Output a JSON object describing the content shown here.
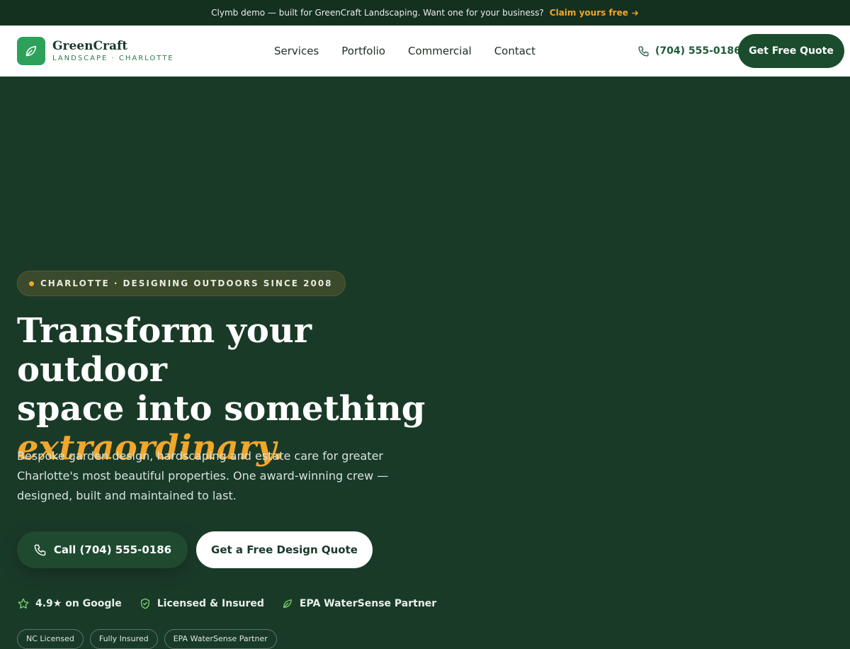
{
  "banner": {
    "text": "Clymb demo — built for GreenCraft Landscaping. Want one for your business?",
    "claim_label": "Claim yours free"
  },
  "header": {
    "logo_name": "GreenCraft",
    "logo_sub": "LANDSCAPE · CHARLOTTE",
    "nav": [
      "Services",
      "Portfolio",
      "Commercial",
      "Contact"
    ],
    "phone": "(704) 555-0186",
    "cta": "Get Free Quote"
  },
  "hero": {
    "badge": "CHARLOTTE · DESIGNING OUTDOORS SINCE 2008",
    "headline_line1": "Transform your outdoor",
    "headline_line2": "space into something",
    "headline_accent": "extraordinary.",
    "subcopy": "Bespoke garden design, hardscaping and estate care for greater Charlotte's most beautiful properties. One award-winning crew — designed, built and maintained to last.",
    "call_button": "Call (704) 555-0186",
    "quote_button": "Get a Free Design Quote",
    "trust": [
      {
        "label": "4.9★ on Google",
        "icon": "star-icon"
      },
      {
        "label": "Licensed & Insured",
        "icon": "shield-check-icon"
      },
      {
        "label": "EPA WaterSense Partner",
        "icon": "leaf-icon"
      }
    ],
    "pills": [
      "NC Licensed",
      "Fully Insured",
      "EPA WaterSense Partner"
    ]
  },
  "colors": {
    "brand_dark": "#1a3a28",
    "brand_green": "#2ea05a",
    "accent": "#f2a62a"
  }
}
